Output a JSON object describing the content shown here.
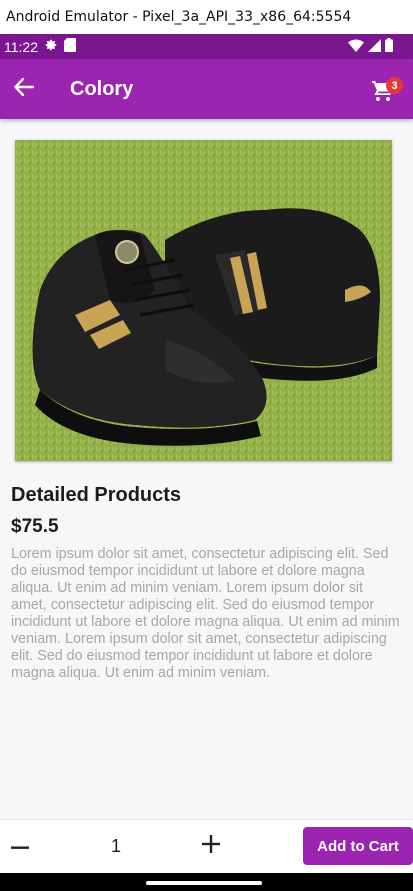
{
  "window": {
    "title": "Android Emulator - Pixel_3a_API_33_x86_64:5554"
  },
  "status_bar": {
    "time": "11:22",
    "icons": [
      "settings-icon",
      "sd-card-icon",
      "wifi-icon",
      "signal-icon",
      "battery-icon"
    ]
  },
  "app_bar": {
    "title": "Colory",
    "back_icon": "arrow-left-icon",
    "cart_icon": "shopping-cart-icon",
    "cart_count": "3"
  },
  "product": {
    "image": "sneaker-photo",
    "name": "Detailed Products",
    "price": "$75.5",
    "description": "Lorem ipsum dolor sit amet, consectetur adipiscing elit. Sed do eiusmod tempor incididunt ut labore et dolore magna aliqua. Ut enim ad minim veniam. Lorem ipsum dolor sit amet, consectetur adipiscing elit. Sed do eiusmod tempor incididunt ut labore et dolore magna aliqua. Ut enim ad minim veniam. Lorem ipsum dolor sit amet, consectetur adipiscing elit. Sed do eiusmod tempor incididunt ut labore et dolore magna aliqua. Ut enim ad minim veniam."
  },
  "bottom_bar": {
    "quantity": "1",
    "minus_icon": "minus-icon",
    "plus_icon": "plus-icon",
    "add_label": "Add to Cart"
  },
  "colors": {
    "primary": "#9b24b0",
    "status_bar": "#7a1790",
    "badge": "#e53935",
    "description_text": "#a7a7a7"
  }
}
